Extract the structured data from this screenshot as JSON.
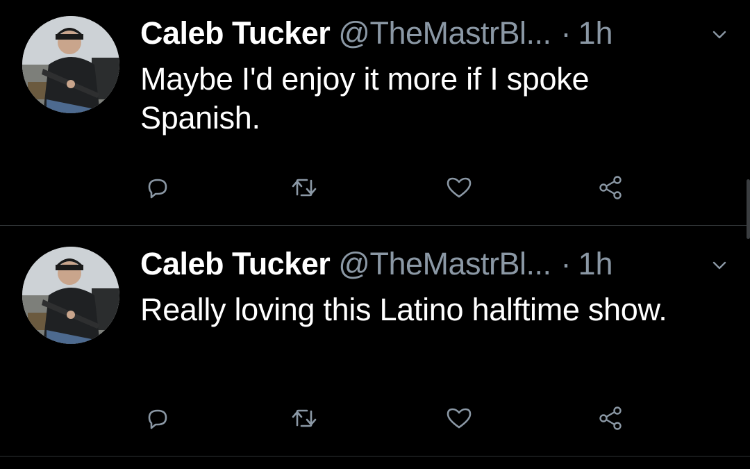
{
  "colors": {
    "background": "#000000",
    "primary_text": "#ffffff",
    "secondary_text": "#8b98a5",
    "divider": "#2f3336"
  },
  "tweets": [
    {
      "display_name": "Caleb Tucker",
      "handle": "@TheMastrBl...",
      "separator": "·",
      "time": "1h",
      "text": "Maybe I'd enjoy it more if I spoke Spanish.",
      "icons": [
        "reply-icon",
        "retweet-icon",
        "like-icon",
        "share-icon",
        "chevron-down-icon"
      ]
    },
    {
      "display_name": "Caleb Tucker",
      "handle": "@TheMastrBl...",
      "separator": "·",
      "time": "1h",
      "text": "Really loving this Latino halftime show.",
      "icons": [
        "reply-icon",
        "retweet-icon",
        "like-icon",
        "share-icon",
        "chevron-down-icon"
      ]
    }
  ]
}
